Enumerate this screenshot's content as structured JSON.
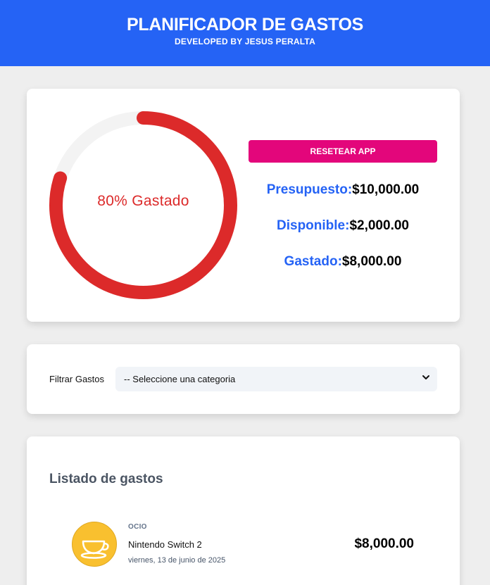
{
  "header": {
    "title": "PLANIFICADOR DE GASTOS",
    "subtitle": "DEVELOPED BY JESUS PERALTA"
  },
  "budget": {
    "percentage": 80,
    "percentage_label": "80% Gastado",
    "reset_label": "RESETEAR APP",
    "stats": [
      {
        "label": "Presupuesto:",
        "value": "$10,000.00"
      },
      {
        "label": "Disponible:",
        "value": "$2,000.00"
      },
      {
        "label": "Gastado:",
        "value": "$8,000.00"
      }
    ],
    "colors": {
      "progress": "#dc2a2a",
      "track": "#f3f3f3",
      "accent": "#2563f5",
      "reset": "#e3067b"
    }
  },
  "filter": {
    "label": "Filtrar Gastos",
    "selected": "-- Seleccione una categoria"
  },
  "list": {
    "title": "Listado de gastos",
    "expenses": [
      {
        "category": "OCIO",
        "name": "Nintendo Switch 2",
        "date": "viernes, 13 de junio de 2025",
        "amount": "$8,000.00",
        "icon": "teacup-icon"
      }
    ]
  }
}
